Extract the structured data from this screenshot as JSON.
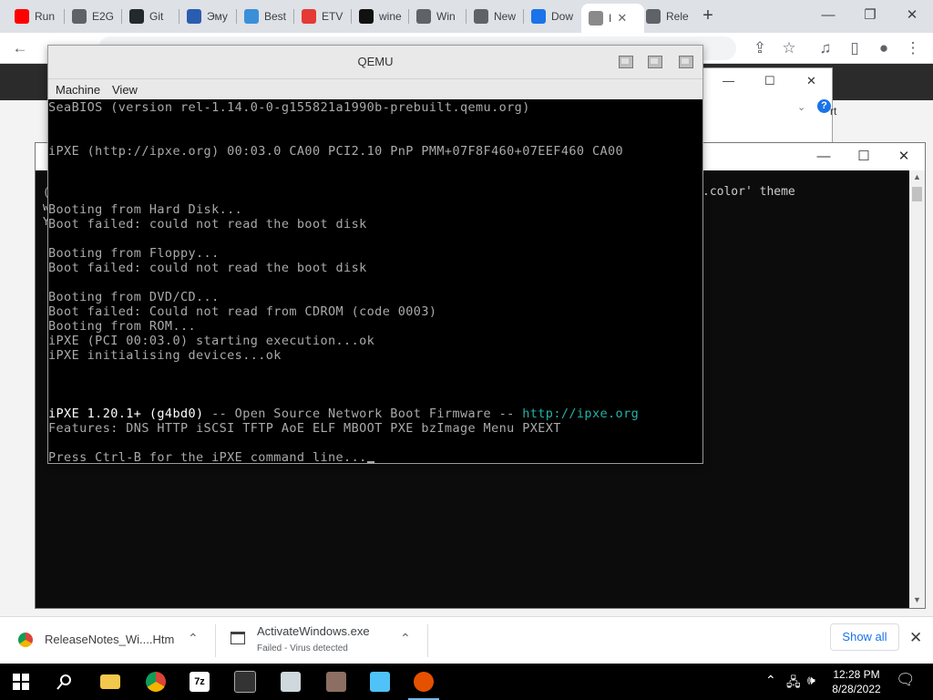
{
  "browser": {
    "tabs": [
      {
        "label": "Run",
        "icon": "youtube-icon",
        "color": "#ff0000"
      },
      {
        "label": "E2G",
        "icon": "chrome-icon",
        "color": "#5f6368"
      },
      {
        "label": "Git",
        "icon": "github-icon",
        "color": "#24292e"
      },
      {
        "label": "Эму",
        "icon": "4s-icon",
        "color": "#2a5db0"
      },
      {
        "label": "Best",
        "icon": "globe-icon",
        "color": "#3a8fd9"
      },
      {
        "label": "ETV",
        "icon": "etv-icon",
        "color": "#e53935"
      },
      {
        "label": "wine",
        "icon": "question-icon",
        "color": "#111111"
      },
      {
        "label": "Win",
        "icon": "chrome-icon",
        "color": "#5f6368"
      },
      {
        "label": "New",
        "icon": "chrome-icon",
        "color": "#5f6368"
      },
      {
        "label": "Dow",
        "icon": "download-icon",
        "color": "#1a73e8"
      },
      {
        "label": "I",
        "icon": "image-icon",
        "color": "#8a8a8a",
        "active": true
      },
      {
        "label": "Rele",
        "icon": "chrome-icon",
        "color": "#5f6368"
      }
    ],
    "new_tab": "+",
    "window_controls": {
      "minimize": "—",
      "restore": "❐",
      "close": "✕"
    },
    "toolbar": {
      "back": "←",
      "share": "⇪",
      "star": "☆",
      "media": "♫",
      "sidepanel": "▯",
      "profile": "●",
      "menu": "⋮"
    }
  },
  "qemu": {
    "title": "QEMU",
    "menu": [
      "Machine",
      "View"
    ],
    "screen_lines": [
      {
        "text": "SeaBIOS (version rel-1.14.0-0-g155821a1990b-prebuilt.qemu.org)",
        "row": 0
      },
      {
        "text": "iPXE (http://ipxe.org) 00:03.0 CA00 PCI2.10 PnP PMM+07F8F460+07EEF460 CA00",
        "row": 3
      },
      {
        "text": "Booting from Hard Disk...",
        "row": 7
      },
      {
        "text": "Boot failed: could not read the boot disk",
        "row": 8
      },
      {
        "text": "Booting from Floppy...",
        "row": 10
      },
      {
        "text": "Boot failed: could not read the boot disk",
        "row": 11
      },
      {
        "text": "Booting from DVD/CD...",
        "row": 13
      },
      {
        "text": "Boot failed: Could not read from CDROM (code 0003)",
        "row": 14
      },
      {
        "text": "Booting from ROM...",
        "row": 15
      },
      {
        "text": "iPXE (PCI 00:03.0) starting execution...ok",
        "row": 16
      },
      {
        "text": "iPXE initialising devices...ok",
        "row": 17
      }
    ],
    "ipxe_banner": {
      "product": "iPXE 1.20.1+ (g4bd0)",
      "middle": " -- Open Source Network Boot Firmware -- ",
      "url": "http://ipxe.org"
    },
    "features": "Features: DNS HTTP iSCSI TFTP AoE ELF MBOOT PXE bzImage Menu PXEXT",
    "prompt": "Press Ctrl-B for the iPXE command line..."
  },
  "terminal": {
    "left_fragments": [
      "(c",
      "wa",
      "Yo"
    ],
    "theme_text": ".color' theme",
    "controls": {
      "minimize": "—",
      "maximize": "☐",
      "close": "✕"
    }
  },
  "explorer": {
    "controls": {
      "minimize": "—",
      "maximize": "☐",
      "close": "✕"
    },
    "help": "?",
    "fragment": "rt"
  },
  "downloads": [
    {
      "name": "ReleaseNotes_Wi....Htm",
      "status": "",
      "icon": "chrome-icon"
    },
    {
      "name": "ActivateWindows.exe",
      "status": "Failed - Virus detected",
      "icon": "exe-icon"
    }
  ],
  "show_all": "Show all",
  "taskbar": {
    "apps": [
      "windows-start-icon",
      "search-icon",
      "file-explorer-icon",
      "chrome-icon",
      "7zip-icon",
      "terminal-icon",
      "app-icon",
      "network-icon",
      "monitor-icon",
      "qemu-icon"
    ],
    "time": "12:28 PM",
    "date": "8/28/2022"
  }
}
